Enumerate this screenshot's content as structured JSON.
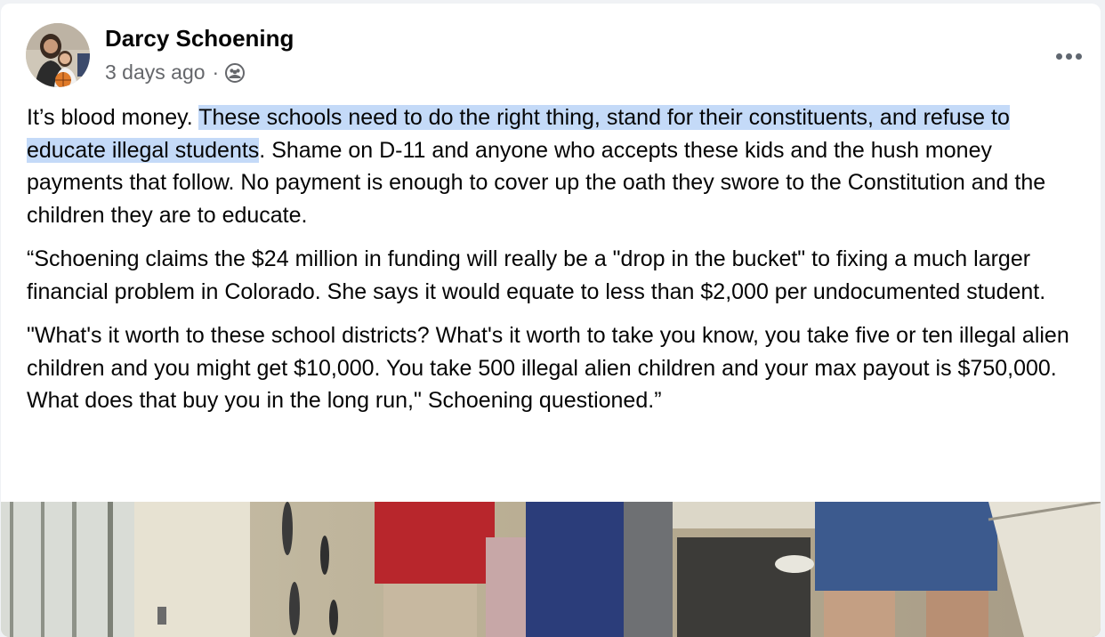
{
  "post": {
    "author": "Darcy Schoening",
    "time": "3 days ago",
    "separator": "·",
    "audience_icon": "friends-icon",
    "more_icon": "more-options-icon",
    "paragraph1": {
      "before": "It’s blood money. ",
      "highlighted": "These schools need to do the right thing, stand for their constituents, and refuse to educate illegal students",
      "after": ". Shame on D-11 and anyone who accepts these kids and the hush money payments that follow. No payment is enough to cover up the oath they swore to the Constitution and the children they are to educate."
    },
    "paragraph2": "“Schoening claims the $24 million in funding will really be a \"drop in the bucket\" to fixing a much larger financial problem in Colorado. She says it would equate to less than $2,000 per undocumented student.",
    "paragraph3": "\"What's it worth to these school districts? What's it worth to take you know, you take five or ten illegal alien children and you might get $10,000. You take 500 illegal alien children and your max payout is $750,000. What does that buy you in the long run,\" Schoening questioned.”"
  },
  "colors": {
    "highlight": "#c4daf8",
    "meta_text": "#65676b",
    "text": "#050505"
  }
}
